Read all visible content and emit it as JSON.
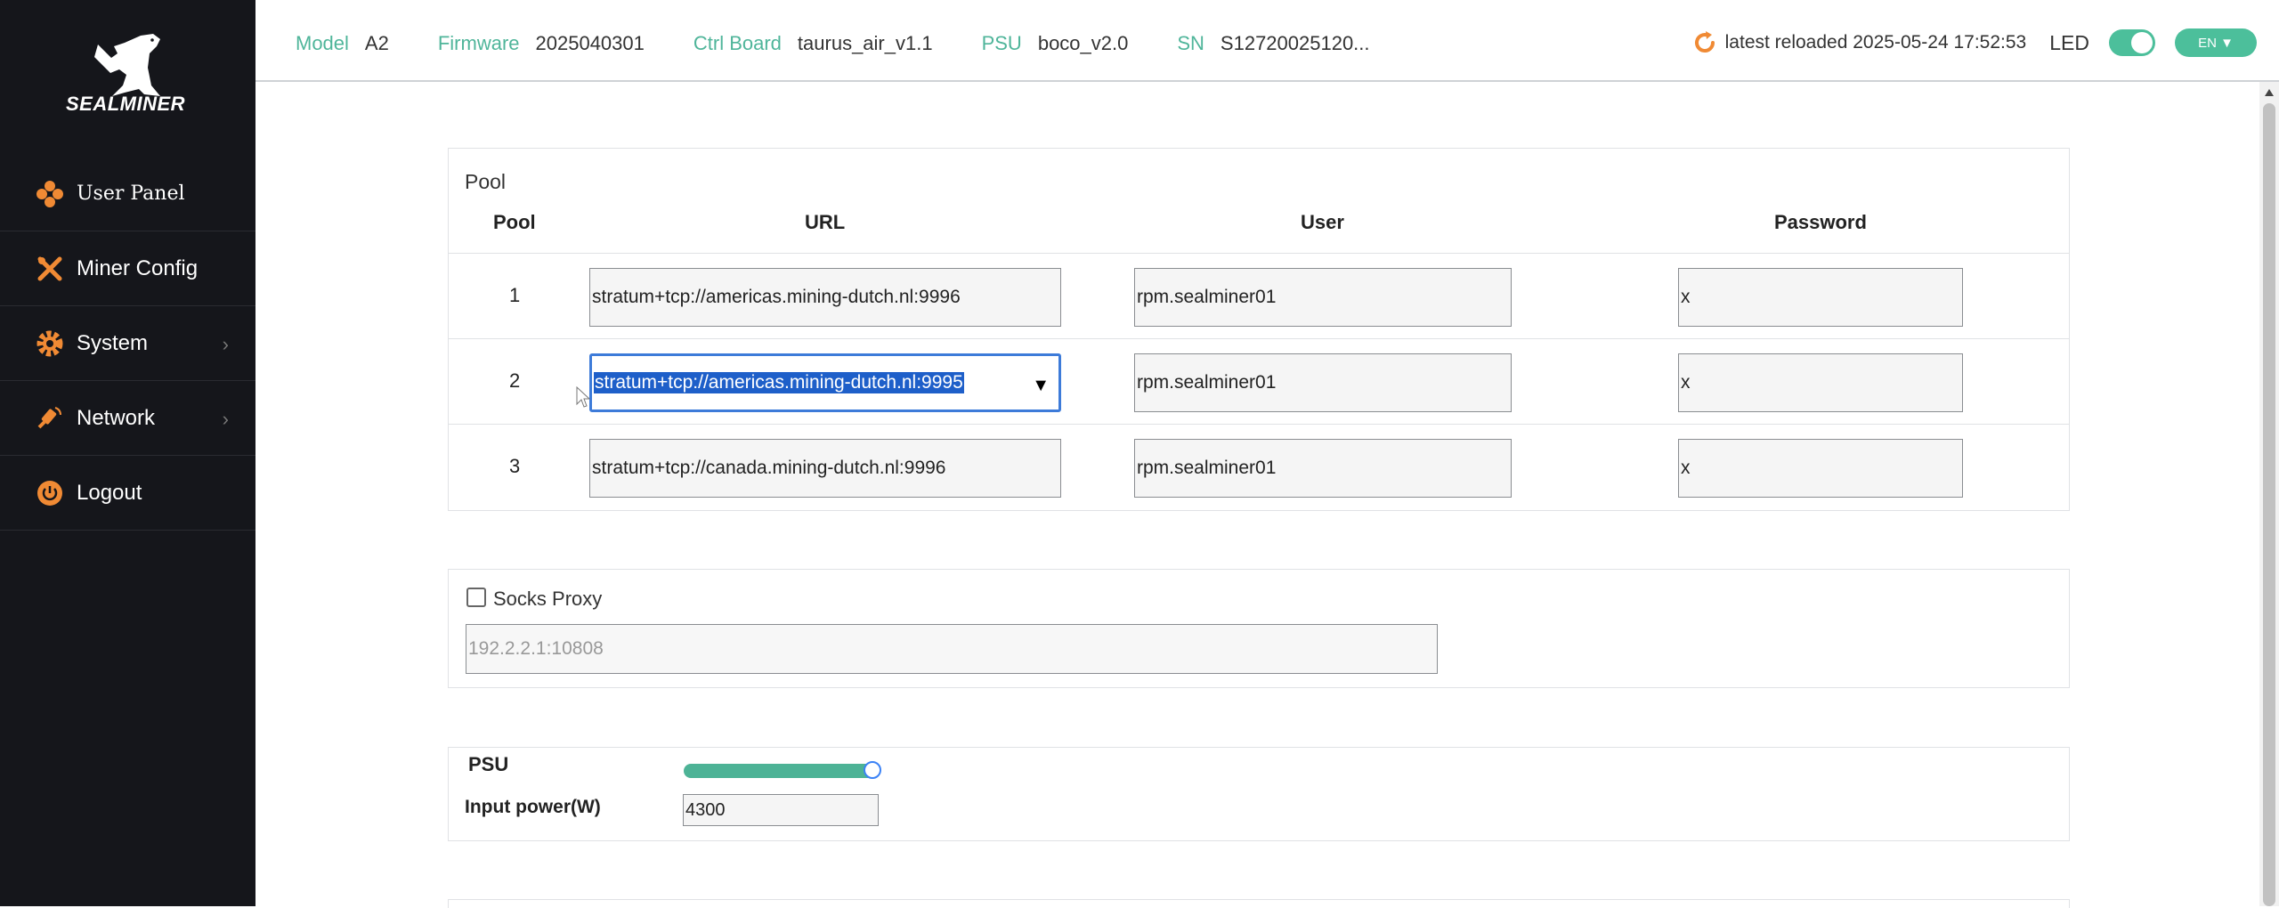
{
  "brand": {
    "logo_text": "SEALMINER"
  },
  "sidebar": {
    "items": [
      {
        "label": "User Panel",
        "icon": "diamond-dots-icon",
        "has_submenu": false
      },
      {
        "label": "Miner Config",
        "icon": "tools-icon",
        "has_submenu": false
      },
      {
        "label": "System",
        "icon": "gear-icon",
        "has_submenu": true
      },
      {
        "label": "Network",
        "icon": "satellite-icon",
        "has_submenu": true
      },
      {
        "label": "Logout",
        "icon": "power-icon",
        "has_submenu": false
      }
    ]
  },
  "header": {
    "model_key": "Model",
    "model_val": "A2",
    "firmware_key": "Firmware",
    "firmware_val": "2025040301",
    "ctrl_key": "Ctrl Board",
    "ctrl_val": "taurus_air_v1.1",
    "psu_key": "PSU",
    "psu_val": "boco_v2.0",
    "sn_key": "SN",
    "sn_val": "S12720025120...",
    "reload_text": "latest reloaded 2025-05-24 17:52:53",
    "led_label": "LED",
    "led_on": true,
    "language": "EN"
  },
  "pool": {
    "title": "Pool",
    "columns": {
      "pool": "Pool",
      "url": "URL",
      "user": "User",
      "password": "Password"
    },
    "rows": [
      {
        "num": "1",
        "url": "stratum+tcp://americas.mining-dutch.nl:9996",
        "user": "rpm.sealminer01",
        "password": "x"
      },
      {
        "num": "2",
        "url": "stratum+tcp://americas.mining-dutch.nl:9995",
        "user": "rpm.sealminer01",
        "password": "x"
      },
      {
        "num": "3",
        "url": "stratum+tcp://canada.mining-dutch.nl:9996",
        "user": "rpm.sealminer01",
        "password": "x"
      }
    ]
  },
  "socks": {
    "label": "Socks Proxy",
    "checked": false,
    "placeholder": "192.2.2.1:10808"
  },
  "psu": {
    "title": "PSU",
    "slider_level": 1.0,
    "input_label": "Input power(W)",
    "input_value": "4300"
  },
  "colors": {
    "accent": "#4cbf9b",
    "sidebar_bg": "#15161b",
    "selection": "#1e5fc9"
  }
}
